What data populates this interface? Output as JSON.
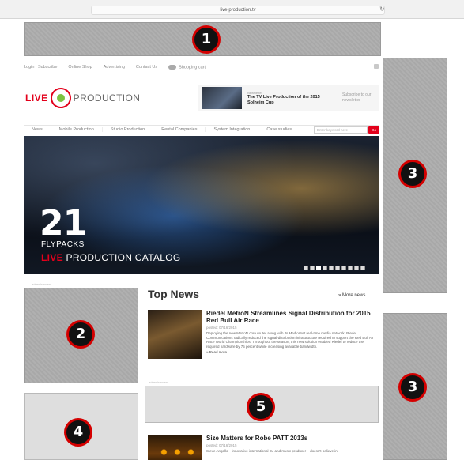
{
  "browser": {
    "url": "live-production.tv",
    "reload_icon": "reload-icon"
  },
  "badges": {
    "b1": "1",
    "b2": "2",
    "b3_top": "3",
    "b3_bottom": "3",
    "b4": "4",
    "b5": "5"
  },
  "topnav": {
    "items": [
      "Login | Subscribe",
      "Online Shop",
      "Advertising",
      "Contact Us"
    ],
    "cart_label": "Shopping cart"
  },
  "logo": {
    "live": "LIVE",
    "production": "PRODUCTION"
  },
  "newsletter": {
    "kicker": "Newsletter",
    "title": "The TV Live Production of the 2015 Solheim Cup",
    "cta": "Subscribe to our newsletter"
  },
  "mainnav": {
    "items": [
      "News",
      "Mobile Production",
      "Studio Production",
      "Rental Companies",
      "System Integration",
      "Case studies"
    ],
    "search_placeholder": "Enter keyword here",
    "go_label": "Go"
  },
  "hero": {
    "big_number": "21",
    "line1": "FLYPACKS",
    "line2_red": "LIVE",
    "line2_rest": " PRODUCTION CATALOG",
    "dots_total": 10,
    "dots_active_index": 2
  },
  "ad_label": "advertisement",
  "top_news": {
    "title": "Top News",
    "more_link": "» More news",
    "articles": [
      {
        "title": "Riedel MetroN Streamlines Signal Distribution for 2015 Red Bull Air Race",
        "date": "posted: 07/16/2015",
        "excerpt": "Deploying the new MetroN core router along with its MediorNet real-time media network, Riedel Communications radically reduced the signal-distribution infrastructure required to support the Red Bull Air Race World Championships. Throughout the season, this new solution enabled Riedel to reduce the required hardware by 75 percent while increasing available bandwidth.",
        "read_more": "» Read more"
      },
      {
        "title": "Size Matters for Robe PATT 2013s",
        "date": "posted: 07/16/2015",
        "excerpt": "Steve Angello – innovative international DJ and music producer – doesn't believe in"
      }
    ]
  },
  "colors": {
    "badge_ring": "#d40000",
    "brand_red": "#e3001b",
    "brand_green": "#7cc242",
    "ad_gray": "#a8a8a8"
  }
}
